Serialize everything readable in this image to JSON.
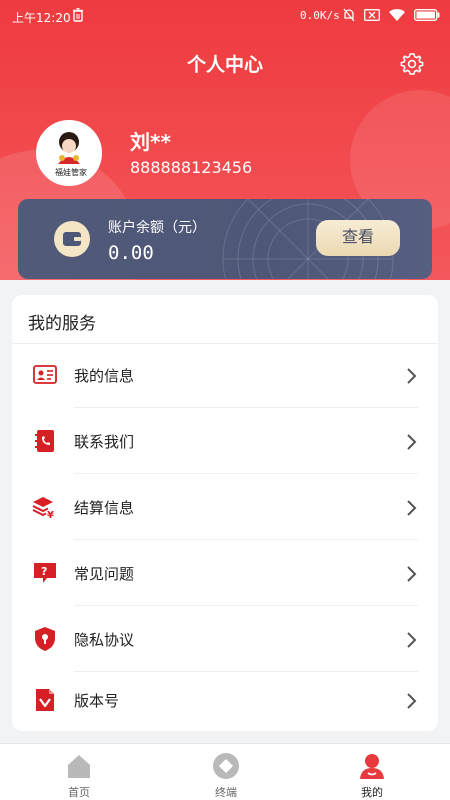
{
  "status_bar": {
    "time": "上午12:20",
    "speed": "0.0K/s"
  },
  "header": {
    "title": "个人中心"
  },
  "user": {
    "name": "刘**",
    "phone": "888888123456",
    "avatar_text": "福娃管家"
  },
  "balance": {
    "label": "账户余额（元）",
    "value": "0.00",
    "button": "查看"
  },
  "services": {
    "heading": "我的服务",
    "items": [
      {
        "label": "我的信息",
        "icon": "id-card-icon"
      },
      {
        "label": "联系我们",
        "icon": "phone-book-icon"
      },
      {
        "label": "结算信息",
        "icon": "yuan-stack-icon"
      },
      {
        "label": "常见问题",
        "icon": "question-bubble-icon"
      },
      {
        "label": "隐私协议",
        "icon": "shield-icon"
      },
      {
        "label": "版本号",
        "icon": "version-doc-icon"
      }
    ]
  },
  "tabs": [
    {
      "label": "首页",
      "icon": "home-icon"
    },
    {
      "label": "终端",
      "icon": "terminal-diamond-icon"
    },
    {
      "label": "我的",
      "icon": "user-icon",
      "active": true
    }
  ],
  "colors": {
    "brand_red": "#ef3b3f",
    "card_slate": "#525a7a",
    "gold": "#f4e5c4"
  }
}
